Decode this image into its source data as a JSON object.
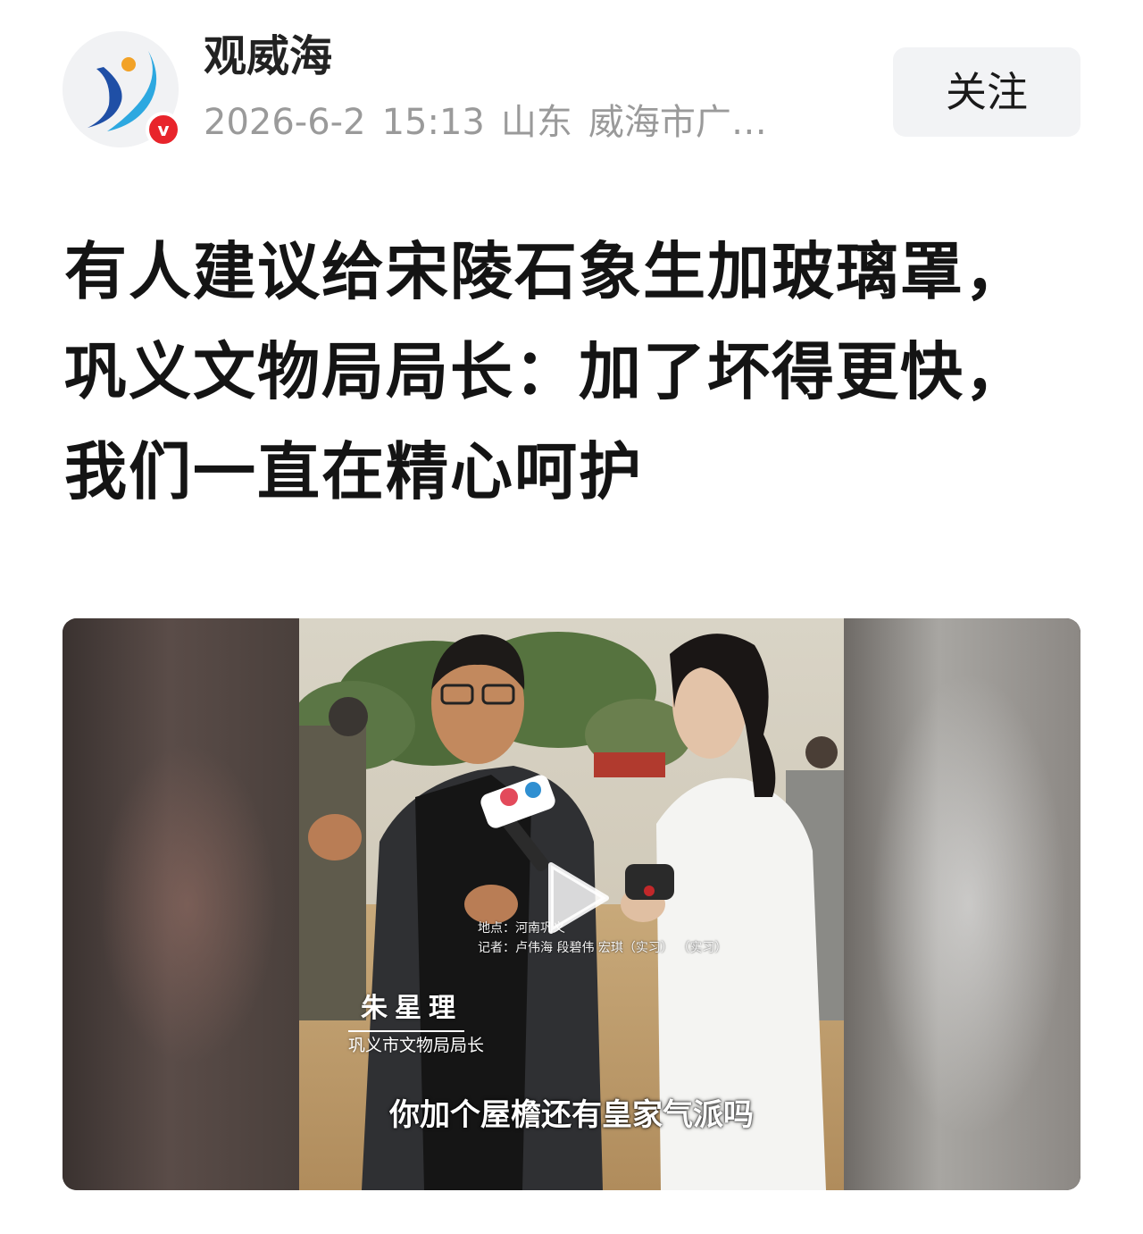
{
  "author": {
    "name": "观威海",
    "verified_mark": "v",
    "date": "2026-6-2",
    "time": "15:13",
    "region": "山东",
    "source": "威海市广…"
  },
  "follow_label": "关注",
  "headline": "有人建议给宋陵石象生加玻璃罩，巩义文物局局长：加了坏得更快，我们一直在精心呵护",
  "video": {
    "name_tag": "朱星理",
    "name_title": "巩义市文物局局长",
    "info_location": "地点：河南巩义",
    "info_reporter": "记者：卢伟海 段碧伟 宏琪（实习）  （实习）",
    "subtitle": "你加个屋檐还有皇家气派吗",
    "play_icon": "play-icon"
  },
  "colors": {
    "verified_badge": "#e8242b",
    "meta_text": "#9a9a9a",
    "follow_bg": "#f2f3f5"
  }
}
